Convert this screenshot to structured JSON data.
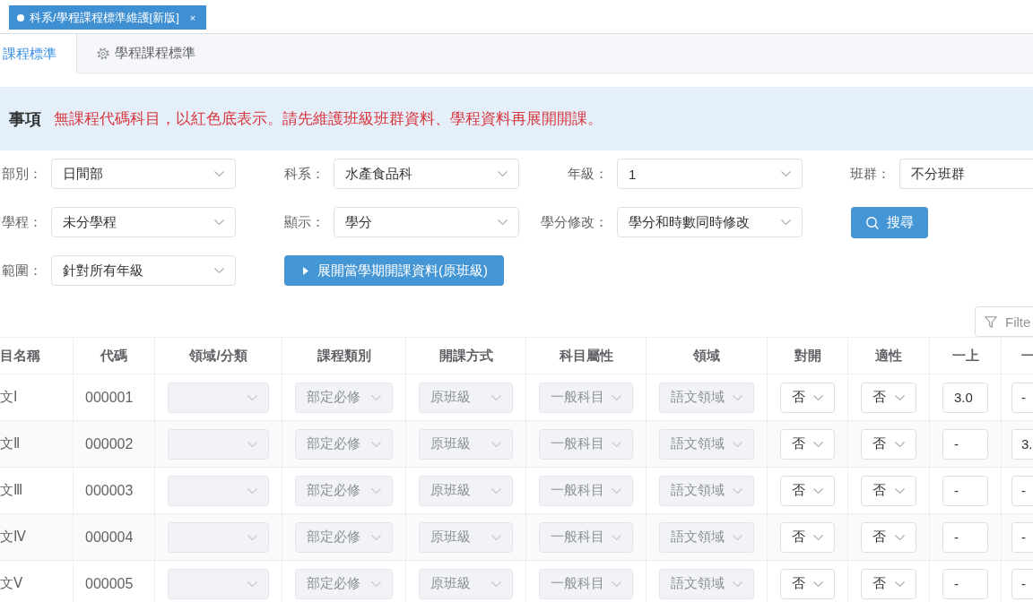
{
  "page_tabs": [
    {
      "label": "科系/學程課程標準維護[新版]",
      "close": "×",
      "selected": true
    }
  ],
  "tabs": [
    {
      "label": "課程標準",
      "selected": true
    },
    {
      "label": "學程課程標準",
      "selected": false
    }
  ],
  "notice": {
    "title": "事項",
    "message": "無課程代碼科目，以紅色底表示。請先維護班級班群資料、學程資料再展開開課。"
  },
  "filter_rows": [
    {
      "items": [
        {
          "kind": "select",
          "label": "部別：",
          "value": "日間部"
        },
        {
          "kind": "select",
          "label": "科系：",
          "value": "水產食品科"
        },
        {
          "kind": "select",
          "label": "年級：",
          "value": "1"
        },
        {
          "kind": "select",
          "label": "班群：",
          "value": "不分班群"
        }
      ]
    },
    {
      "items": [
        {
          "kind": "select",
          "label": "學程：",
          "value": "未分學程"
        },
        {
          "kind": "select",
          "label": "顯示：",
          "value": "學分"
        },
        {
          "kind": "select",
          "label": "學分修改：",
          "value": "學分和時數同時修改"
        },
        {
          "kind": "search",
          "label": "搜尋"
        }
      ]
    },
    {
      "items": [
        {
          "kind": "select",
          "label": "範圍：",
          "value": "針對所有年級"
        },
        {
          "kind": "expand",
          "label": "展開當學期開課資料(原班級)"
        }
      ]
    }
  ],
  "filter_button": {
    "label": "Filte"
  },
  "table": {
    "columns": [
      "目名稱",
      "代碼",
      "領域/分類",
      "課程類別",
      "開課方式",
      "科目屬性",
      "領域",
      "對開",
      "適性",
      "一上",
      "一"
    ],
    "rows": [
      {
        "cells": [
          {
            "kind": "text",
            "text": "文Ⅰ"
          },
          {
            "kind": "text",
            "text": "000001"
          },
          {
            "kind": "select",
            "disabled": true
          },
          {
            "kind": "select",
            "value": "部定必修",
            "disabled": true
          },
          {
            "kind": "select",
            "value": "原班級",
            "disabled": true
          },
          {
            "kind": "select",
            "value": "一般科目",
            "disabled": true
          },
          {
            "kind": "select",
            "value": "語文領域",
            "disabled": true
          },
          {
            "kind": "select",
            "value": "否",
            "disabled": false
          },
          {
            "kind": "select",
            "value": "否",
            "disabled": false
          },
          {
            "kind": "input",
            "value": "3.0"
          },
          {
            "kind": "input",
            "value": "-"
          }
        ]
      },
      {
        "cells": [
          {
            "kind": "text",
            "text": "文Ⅱ"
          },
          {
            "kind": "text",
            "text": "000002"
          },
          {
            "kind": "select",
            "disabled": true
          },
          {
            "kind": "select",
            "value": "部定必修",
            "disabled": true
          },
          {
            "kind": "select",
            "value": "原班級",
            "disabled": true
          },
          {
            "kind": "select",
            "value": "一般科目",
            "disabled": true
          },
          {
            "kind": "select",
            "value": "語文領域",
            "disabled": true
          },
          {
            "kind": "select",
            "value": "否",
            "disabled": false
          },
          {
            "kind": "select",
            "value": "否",
            "disabled": false
          },
          {
            "kind": "input",
            "value": "-"
          },
          {
            "kind": "input",
            "value": "3."
          }
        ]
      },
      {
        "cells": [
          {
            "kind": "text",
            "text": "文Ⅲ"
          },
          {
            "kind": "text",
            "text": "000003"
          },
          {
            "kind": "select",
            "disabled": true
          },
          {
            "kind": "select",
            "value": "部定必修",
            "disabled": true
          },
          {
            "kind": "select",
            "value": "原班級",
            "disabled": true
          },
          {
            "kind": "select",
            "value": "一般科目",
            "disabled": true
          },
          {
            "kind": "select",
            "value": "語文領域",
            "disabled": true
          },
          {
            "kind": "select",
            "value": "否",
            "disabled": false
          },
          {
            "kind": "select",
            "value": "否",
            "disabled": false
          },
          {
            "kind": "input",
            "value": "-"
          },
          {
            "kind": "input",
            "value": "-"
          }
        ]
      },
      {
        "cells": [
          {
            "kind": "text",
            "text": "文Ⅳ"
          },
          {
            "kind": "text",
            "text": "000004"
          },
          {
            "kind": "select",
            "disabled": true
          },
          {
            "kind": "select",
            "value": "部定必修",
            "disabled": true
          },
          {
            "kind": "select",
            "value": "原班級",
            "disabled": true
          },
          {
            "kind": "select",
            "value": "一般科目",
            "disabled": true
          },
          {
            "kind": "select",
            "value": "語文領域",
            "disabled": true
          },
          {
            "kind": "select",
            "value": "否",
            "disabled": false
          },
          {
            "kind": "select",
            "value": "否",
            "disabled": false
          },
          {
            "kind": "input",
            "value": "-"
          },
          {
            "kind": "input",
            "value": "-"
          }
        ]
      },
      {
        "cells": [
          {
            "kind": "text",
            "text": "文Ⅴ"
          },
          {
            "kind": "text",
            "text": "000005"
          },
          {
            "kind": "select",
            "disabled": true
          },
          {
            "kind": "select",
            "value": "部定必修",
            "disabled": true
          },
          {
            "kind": "select",
            "value": "原班級",
            "disabled": true
          },
          {
            "kind": "select",
            "value": "一般科目",
            "disabled": true
          },
          {
            "kind": "select",
            "value": "語文領域",
            "disabled": true
          },
          {
            "kind": "select",
            "value": "否",
            "disabled": false
          },
          {
            "kind": "select",
            "value": "否",
            "disabled": false
          },
          {
            "kind": "input",
            "value": "-"
          },
          {
            "kind": "input",
            "value": "-"
          }
        ]
      }
    ]
  }
}
